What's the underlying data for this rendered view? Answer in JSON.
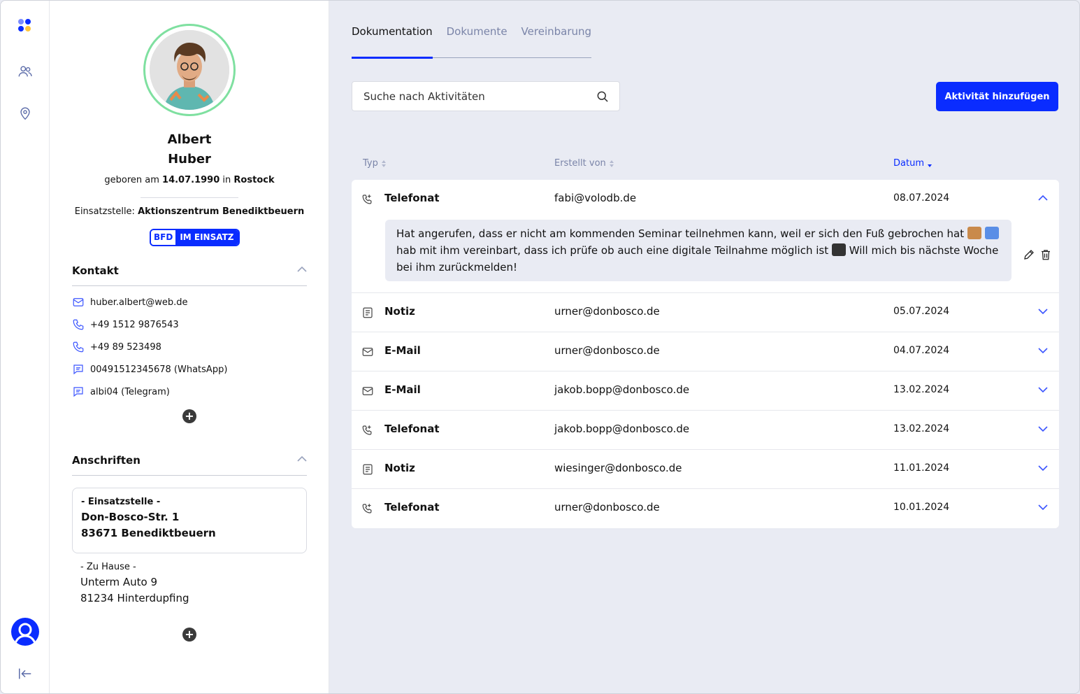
{
  "colors": {
    "accent": "#0a2cff",
    "ring": "#7fe0a0",
    "muted": "#7a84a8",
    "bg": "#e9ebf3"
  },
  "rail": {
    "icons": [
      "logo",
      "users-icon",
      "location-pin-icon",
      "user-avatar-icon",
      "collapse-sidebar-icon"
    ]
  },
  "profile": {
    "first_name": "Albert",
    "last_name": "Huber",
    "birth_prefix": "geboren am",
    "birth_date": "14.07.1990",
    "birth_in": "in",
    "birth_place": "Rostock",
    "station_label": "Einsatzstelle:",
    "station_name": "Aktionszentrum Benediktbeuern",
    "badge_program": "BFD",
    "badge_status": "IM EINSATZ"
  },
  "contact": {
    "title": "Kontakt",
    "items": [
      {
        "icon": "mail-icon",
        "value": "huber.albert@web.de"
      },
      {
        "icon": "phone-icon",
        "value": "+49 1512 9876543"
      },
      {
        "icon": "phone-icon",
        "value": "+49 89 523498"
      },
      {
        "icon": "chat-icon",
        "value": "00491512345678 (WhatsApp)"
      },
      {
        "icon": "chat-icon",
        "value": "albi04 (Telegram)"
      }
    ],
    "add_label": "+"
  },
  "addresses": {
    "title": "Anschriften",
    "primary": {
      "label": "- Einsatzstelle -",
      "street": "Don-Bosco-Str. 1",
      "city": "83671 Benediktbeuern"
    },
    "home": {
      "label": "- Zu Hause -",
      "street": "Unterm Auto 9",
      "city": "81234 Hinterdupfing"
    },
    "add_label": "+"
  },
  "tabs": [
    "Dokumentation",
    "Dokumente",
    "Vereinbarung"
  ],
  "search": {
    "placeholder": "Suche nach Aktivitäten"
  },
  "add_button": "Aktivität hinzufügen",
  "columns": {
    "type": "Typ",
    "created_by": "Erstellt von",
    "date": "Datum"
  },
  "activities": [
    {
      "icon": "phone-call-icon",
      "type": "Telefonat",
      "by": "fabi@volodb.de",
      "date": "08.07.2024",
      "expanded": true,
      "note_1": "Hat angerufen, dass er nicht am kommenden Seminar teilnehmen kann, weil er sich den Fuß gebrochen hat",
      "note_2": "hab mit ihm vereinbart, dass ich prüfe ob auch eine digitale Teilnahme möglich ist",
      "note_3": "Will mich bis nächste Woche bei ihm zurückmelden!"
    },
    {
      "icon": "note-icon",
      "type": "Notiz",
      "by": "urner@donbosco.de",
      "date": "05.07.2024"
    },
    {
      "icon": "mail-icon",
      "type": "E-Mail",
      "by": "urner@donbosco.de",
      "date": "04.07.2024"
    },
    {
      "icon": "mail-icon",
      "type": "E-Mail",
      "by": "jakob.bopp@donbosco.de",
      "date": "13.02.2024"
    },
    {
      "icon": "phone-call-icon",
      "type": "Telefonat",
      "by": "jakob.bopp@donbosco.de",
      "date": "13.02.2024"
    },
    {
      "icon": "note-icon",
      "type": "Notiz",
      "by": "wiesinger@donbosco.de",
      "date": "11.01.2024"
    },
    {
      "icon": "phone-call-icon",
      "type": "Telefonat",
      "by": "urner@donbosco.de",
      "date": "10.01.2024"
    }
  ]
}
